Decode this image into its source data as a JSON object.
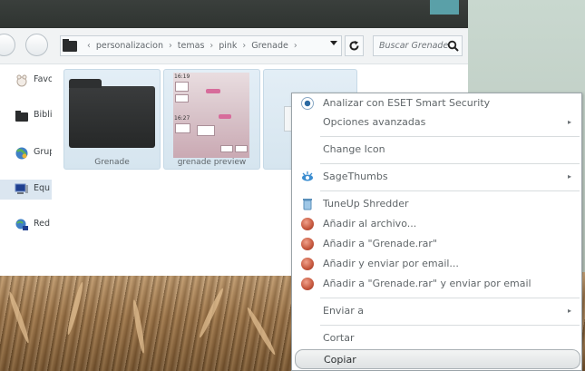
{
  "address_bar": {
    "segments": [
      "personalizacion",
      "temas",
      "pink",
      "Grenade"
    ]
  },
  "search": {
    "placeholder": "Buscar Grenade"
  },
  "sidebar": {
    "items": [
      {
        "label": "Favo",
        "icon": "favorites-icon"
      },
      {
        "label": "Bibli",
        "icon": "libraries-icon"
      },
      {
        "label": "Grup",
        "icon": "homegroup-icon"
      },
      {
        "label": "Equ",
        "icon": "computer-icon",
        "selected": true
      },
      {
        "label": "Red",
        "icon": "network-icon"
      }
    ]
  },
  "content": {
    "items": [
      {
        "caption": "Grenade",
        "type": "folder"
      },
      {
        "caption": "grenade preview",
        "type": "image",
        "times": [
          "16:19",
          "16:27"
        ]
      },
      {
        "caption": "",
        "type": "file-selected"
      }
    ]
  },
  "context_menu": {
    "items": [
      {
        "label": "Analizar con ESET Smart Security",
        "icon": "eset-icon"
      },
      {
        "label": "Opciones avanzadas",
        "submenu": true
      },
      {
        "label": "Change Icon"
      },
      {
        "label": "SageThumbs",
        "icon": "sagethumbs-icon",
        "submenu": true
      },
      {
        "label": "TuneUp Shredder",
        "icon": "shredder-icon"
      },
      {
        "label": "Añadir al archivo...",
        "icon": "winrar-icon"
      },
      {
        "label": "Añadir a \"Grenade.rar\"",
        "icon": "winrar-icon"
      },
      {
        "label": "Añadir y enviar por email...",
        "icon": "winrar-icon"
      },
      {
        "label": "Añadir a \"Grenade.rar\" y enviar por email",
        "icon": "winrar-icon"
      },
      {
        "label": "Enviar a",
        "submenu": true
      },
      {
        "label": "Cortar"
      },
      {
        "label": "Copiar",
        "highlighted": true
      }
    ]
  },
  "colors": {
    "titlebar": "#2f3431",
    "accent": "#5aa0a8",
    "highlight": "#dfe2e3"
  }
}
